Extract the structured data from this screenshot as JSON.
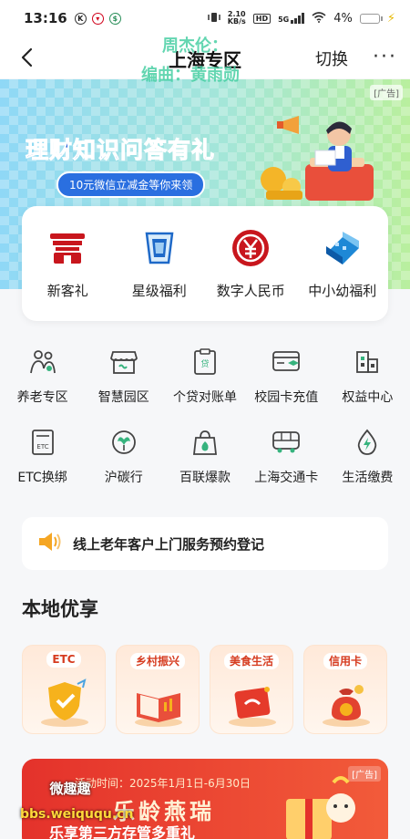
{
  "status_bar": {
    "time": "13:16",
    "left_icons": [
      "k-icon",
      "app-red-icon",
      "app-green-icon"
    ],
    "net_speed_value": "2.10",
    "net_speed_unit": "KB/s",
    "hd": "HD",
    "network": "5G",
    "battery": "4%"
  },
  "nav": {
    "title": "上海专区",
    "switch_label": "切换",
    "more_label": "···"
  },
  "overlay": {
    "watermark_line1": "周杰伦：",
    "watermark_line2": "编曲：黄雨勋"
  },
  "banner": {
    "ad_tag": "[广告]",
    "title": "理财知识问答有礼",
    "pill": "10元微信立减金等你来领"
  },
  "main_menu": [
    {
      "label": "新客礼",
      "icon": "gate-icon"
    },
    {
      "label": "星级福利",
      "icon": "card-stack-icon"
    },
    {
      "label": "数字人民币",
      "icon": "digital-rmb-icon"
    },
    {
      "label": "中小幼福利",
      "icon": "building-icon"
    }
  ],
  "services": [
    [
      {
        "label": "养老专区",
        "icon": "elderly-icon"
      },
      {
        "label": "智慧园区",
        "icon": "store-icon"
      },
      {
        "label": "个贷对账单",
        "icon": "loan-doc-icon"
      },
      {
        "label": "校园卡充值",
        "icon": "campus-card-icon"
      },
      {
        "label": "权益中心",
        "icon": "rights-center-icon"
      }
    ],
    [
      {
        "label": "ETC换绑",
        "icon": "etc-icon"
      },
      {
        "label": "沪碳行",
        "icon": "leaf-icon"
      },
      {
        "label": "百联爆款",
        "icon": "fire-bag-icon"
      },
      {
        "label": "上海交通卡",
        "icon": "bus-icon"
      },
      {
        "label": "生活缴费",
        "icon": "utility-drop-icon"
      }
    ]
  ],
  "notice": {
    "text": "线上老年客户上门服务预约登记",
    "icon": "speaker-icon"
  },
  "local": {
    "title": "本地优享",
    "cards": [
      {
        "tag": "ETC"
      },
      {
        "tag": "乡村振兴"
      },
      {
        "tag": "美食生活"
      },
      {
        "tag": "信用卡"
      }
    ]
  },
  "promo": {
    "date": "活动时间：2025年1月1日-6月30日",
    "ad_tag": "[广告]",
    "brand": "乐龄燕瑞",
    "headline": "乐享第三方存管多重礼"
  },
  "site_mark": {
    "name": "微趣趣",
    "url": "bbs.weiququ.cn"
  },
  "colors": {
    "accent_blue": "#1a55d6",
    "accent_red": "#d0021b",
    "watermark_green": "#49d0a4",
    "promo_red": "#e4322b"
  }
}
